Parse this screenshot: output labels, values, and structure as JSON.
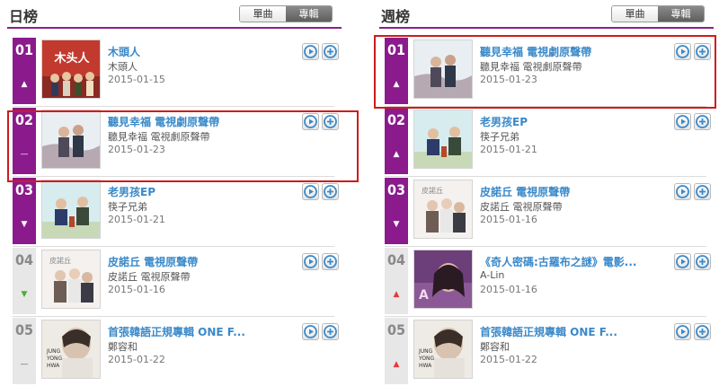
{
  "daily": {
    "title": "日榜",
    "tabs": [
      {
        "label": "單曲",
        "active": false
      },
      {
        "label": "專輯",
        "active": true
      }
    ],
    "items": [
      {
        "rank": "01",
        "trend": "up",
        "title": "木頭人",
        "artist": "木頭人",
        "date": "2015-01-15",
        "cover": "mutouren"
      },
      {
        "rank": "02",
        "trend": "flat",
        "title": "聽見幸福 電視劇原聲帶",
        "artist": "聽見幸福 電視劇原聲帶",
        "date": "2015-01-23",
        "cover": "tingjian"
      },
      {
        "rank": "03",
        "trend": "down",
        "title": "老男孩EP",
        "artist": "筷子兄弟",
        "date": "2015-01-21",
        "cover": "laonanhai"
      },
      {
        "rank": "04",
        "trend": "down",
        "title": "皮諾丘 電視原聲帶",
        "artist": "皮諾丘 電視原聲帶",
        "date": "2015-01-16",
        "cover": "pinuoqiu"
      },
      {
        "rank": "05",
        "trend": "flat",
        "title": "首張韓語正規專輯 ONE F...",
        "artist": "鄭容和",
        "date": "2015-01-22",
        "cover": "jungyonghwa"
      }
    ]
  },
  "weekly": {
    "title": "週榜",
    "tabs": [
      {
        "label": "單曲",
        "active": false
      },
      {
        "label": "專輯",
        "active": true
      }
    ],
    "items": [
      {
        "rank": "01",
        "trend": "up",
        "title": "聽見幸福 電視劇原聲帶",
        "artist": "聽見幸福 電視劇原聲帶",
        "date": "2015-01-23",
        "cover": "tingjian"
      },
      {
        "rank": "02",
        "trend": "up",
        "title": "老男孩EP",
        "artist": "筷子兄弟",
        "date": "2015-01-21",
        "cover": "laonanhai"
      },
      {
        "rank": "03",
        "trend": "down",
        "title": "皮諾丘 電視原聲帶",
        "artist": "皮諾丘 電視原聲帶",
        "date": "2015-01-16",
        "cover": "pinuoqiu"
      },
      {
        "rank": "04",
        "trend": "up",
        "title": "《奇人密碼:古羅布之謎》電影...",
        "artist": "A-Lin",
        "date": "2015-01-16",
        "cover": "alin"
      },
      {
        "rank": "05",
        "trend": "up",
        "title": "首張韓語正規專輯 ONE F...",
        "artist": "鄭容和",
        "date": "2015-01-22",
        "cover": "jungyonghwa"
      }
    ]
  },
  "colors": {
    "accent": "#8b1a8c",
    "link": "#3a89c9",
    "highlight": "#d11b1b"
  },
  "icons": {
    "play": "play-circle-icon",
    "add": "add-circle-icon",
    "up": "arrow-up-icon",
    "down": "arrow-down-icon",
    "flat": "dash-icon"
  }
}
